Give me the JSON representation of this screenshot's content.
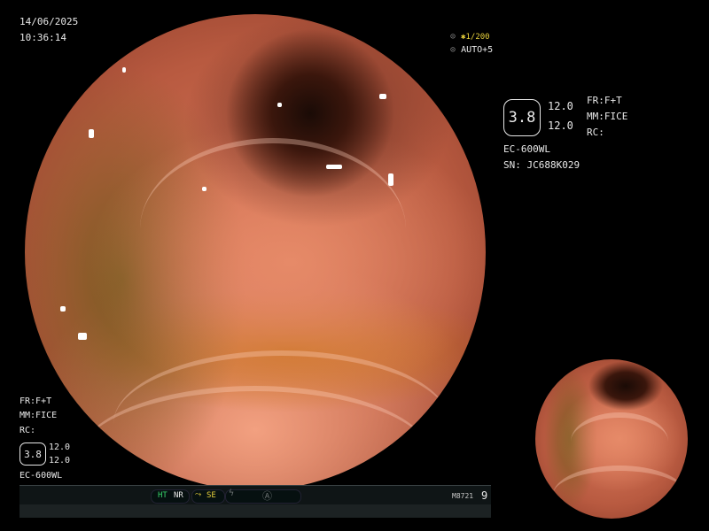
{
  "datetime": {
    "date": "14/06/2025",
    "time": "10:36:14"
  },
  "top_right": {
    "shutter": "1/200",
    "auto": "AUTO+5"
  },
  "info_panel": {
    "zoom_value": "3.8",
    "param_1": "12.0",
    "param_2": "12.0",
    "fr": "FR:F+T",
    "mm": "MM:FICE",
    "rc": "RC:",
    "model": "EC-600WL",
    "serial": "SN: JC688K029"
  },
  "left_panel": {
    "fr": "FR:F+T",
    "mm": "MM:FICE",
    "rc": "RC:",
    "zoom_value": "3.8",
    "param_1": "12.0",
    "param_2": "12.0",
    "model": "EC-600WL"
  },
  "status_bar": {
    "ht": "HT",
    "nr": "NR",
    "se": "SE",
    "code": "M8721",
    "count": "9"
  },
  "colors": {
    "green": "#36d26a",
    "yellow": "#e7d03b"
  },
  "icons": [
    "asterisk-icon",
    "auto-gain-icon",
    "scope-arrow-icon",
    "lightning-icon",
    "record-icon"
  ]
}
